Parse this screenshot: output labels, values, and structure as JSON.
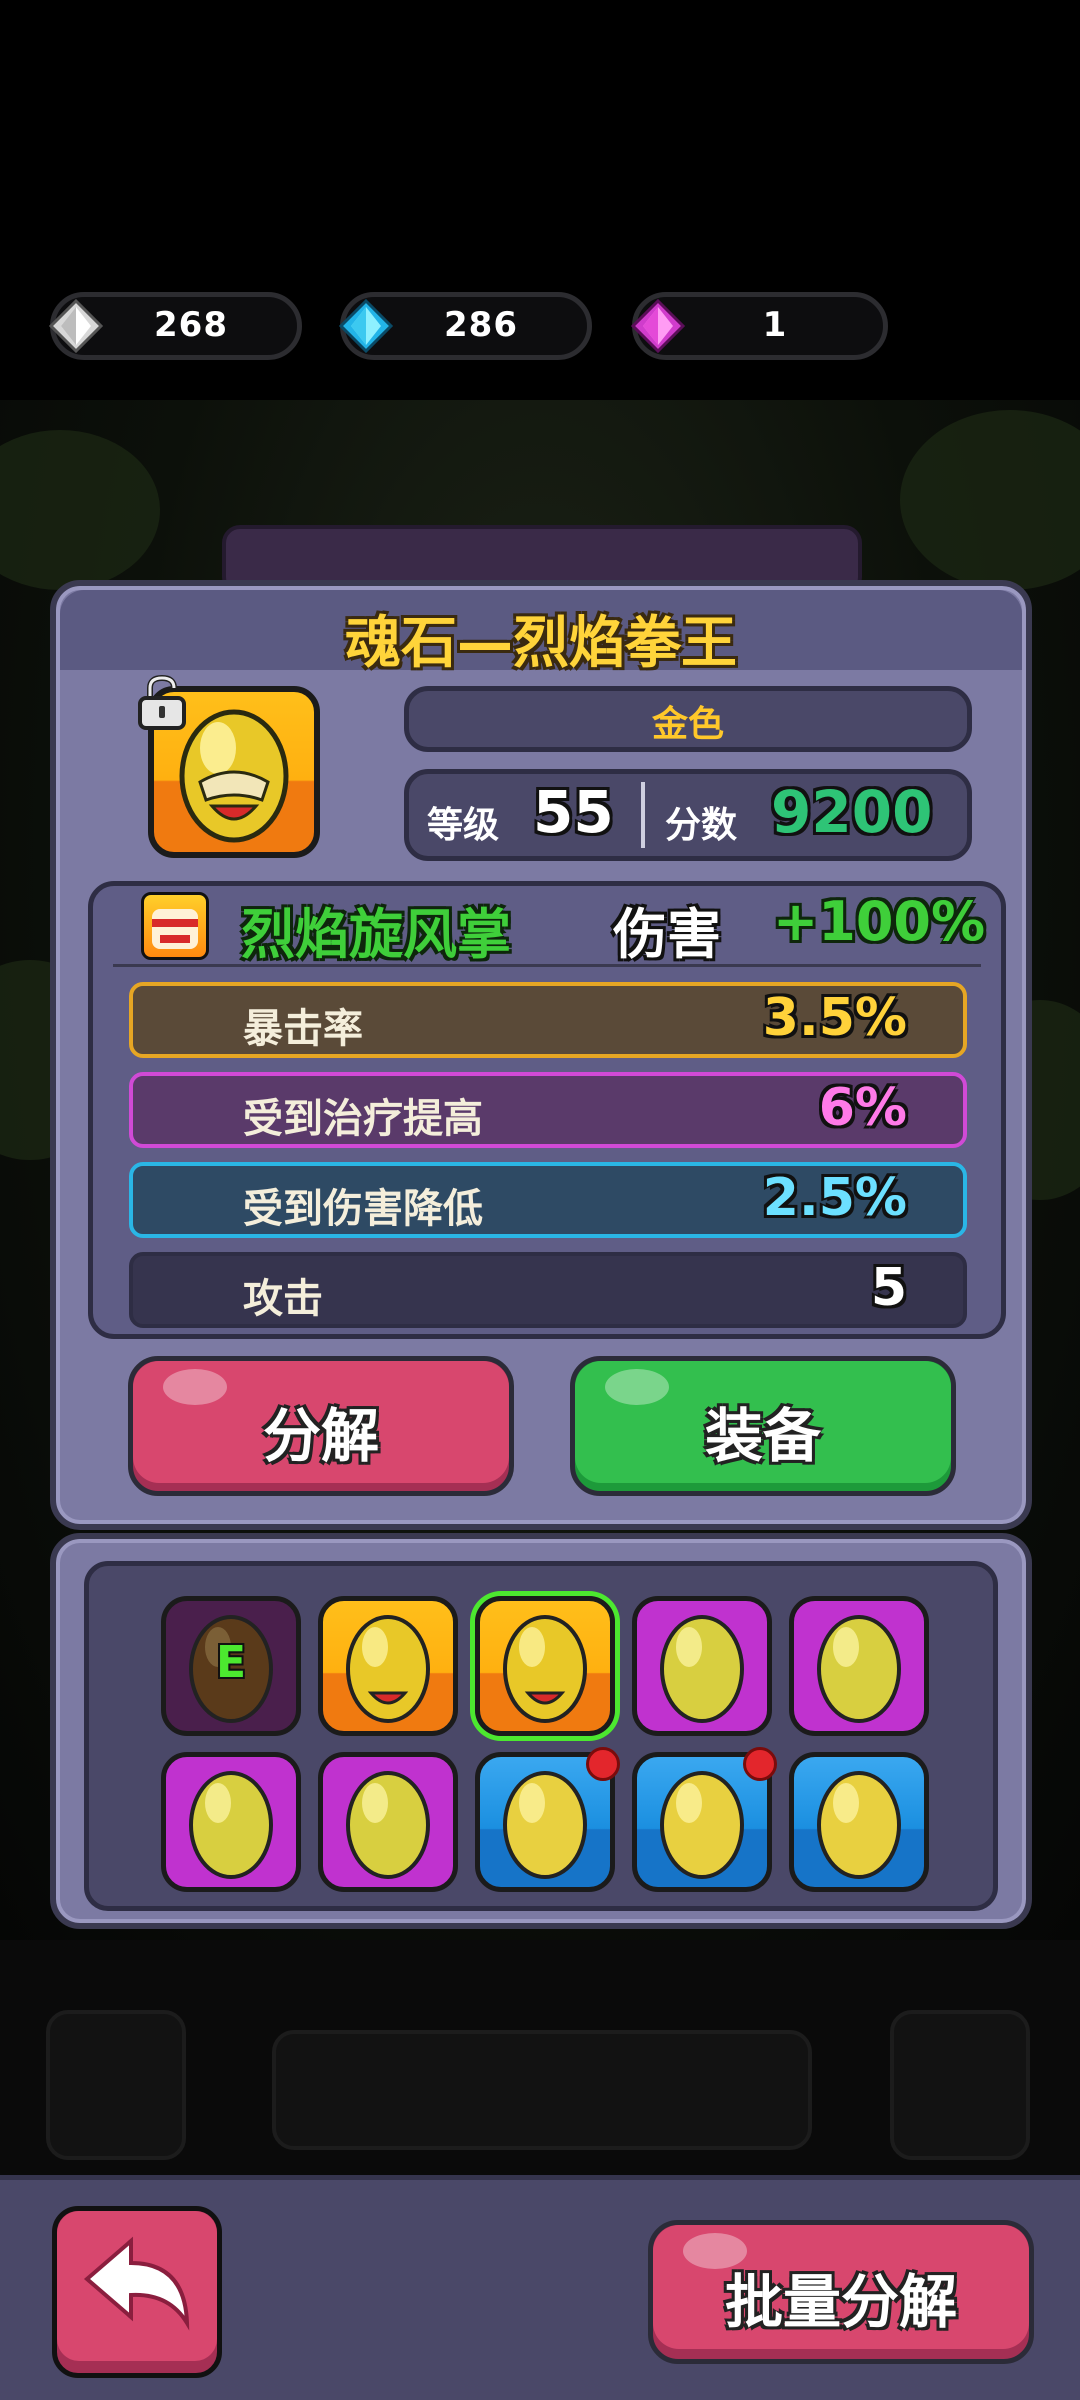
{
  "currencies": [
    {
      "icon": "silver-diamond-icon",
      "value": "268",
      "color": "#e8e8e8"
    },
    {
      "icon": "blue-diamond-icon",
      "value": "286",
      "color": "#3cc9f0"
    },
    {
      "icon": "purple-diamond-icon",
      "value": "1",
      "color": "#e44ad8"
    }
  ],
  "item": {
    "title": "魂石—烈焰拳王",
    "quality": "金色",
    "level_label": "等级",
    "level": "55",
    "score_label": "分数",
    "score": "9200",
    "locked": true
  },
  "skill": {
    "name": "烈焰旋风掌",
    "effect_label": "伤害",
    "effect_value": "+100%"
  },
  "attributes": [
    {
      "label": "暴击率",
      "value": "3.5%",
      "bg": "#5a4a38",
      "border": "#e6a624",
      "value_color": "#ffd23a"
    },
    {
      "label": "受到治疗提高",
      "value": "6%",
      "bg": "#5a3a6a",
      "border": "#d04ad6",
      "value_color": "#ff7ae8"
    },
    {
      "label": "受到伤害降低",
      "value": "2.5%",
      "bg": "#2e4a64",
      "border": "#2ab6e6",
      "value_color": "#6ce0ff"
    },
    {
      "label": "攻击",
      "value": "5",
      "bg": "#36344e",
      "border": "#2e2d44",
      "value_color": "#ffffff"
    }
  ],
  "buttons": {
    "decompose": "分解",
    "equip": "装备",
    "batch_decompose": "批量分解"
  },
  "inventory": [
    {
      "rarity": "equipped",
      "bg": "#4a1f4c",
      "equipped_mark": "E"
    },
    {
      "rarity": "gold",
      "bg": "#ffb010",
      "selected": false
    },
    {
      "rarity": "gold",
      "bg": "#ffb010",
      "selected": true
    },
    {
      "rarity": "purple",
      "bg": "#c032cf"
    },
    {
      "rarity": "purple",
      "bg": "#c032cf"
    },
    {
      "rarity": "purple",
      "bg": "#c032cf"
    },
    {
      "rarity": "purple",
      "bg": "#c032cf"
    },
    {
      "rarity": "blue",
      "bg": "#1b8fe0",
      "new": true
    },
    {
      "rarity": "blue",
      "bg": "#1b8fe0",
      "new": true
    },
    {
      "rarity": "blue",
      "bg": "#1b8fe0"
    }
  ]
}
